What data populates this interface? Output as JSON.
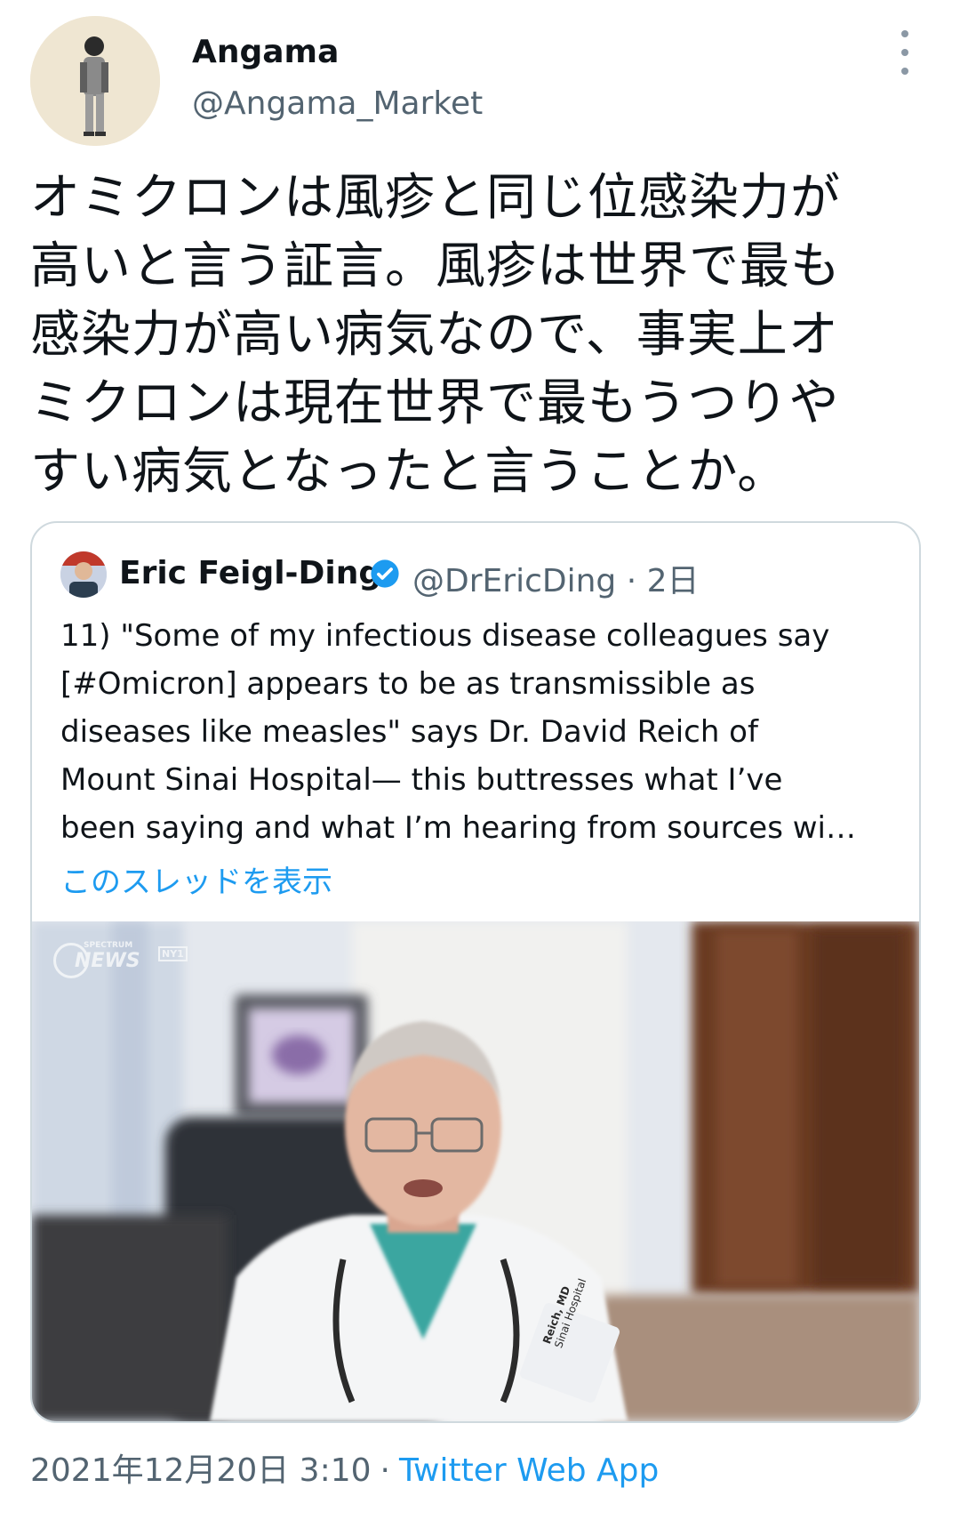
{
  "author": {
    "display_name": "Angama",
    "handle": "@Angama_Market"
  },
  "tweet": {
    "lines": [
      "オミクロンは風疹と同じ位感染力が",
      "高いと言う証言。風疹は世界で最も",
      "感染力が高い病気なので、事実上オ",
      "ミクロンは現在世界で最もうつりや",
      "すい病気となったと言うことか。"
    ]
  },
  "quote": {
    "display_name": "Eric Feigl-Ding",
    "handle_and_time": "@DrEricDing · 2日",
    "lines": [
      "11) \"Some of my infectious disease colleagues say",
      "[#Omicron] appears to be as transmissible as",
      "diseases like measles\" says Dr. David Reich of",
      "Mount Sinai Hospital— this buttresses what I’ve",
      "been saying and what I’m hearing from sources wi…"
    ],
    "show_thread": "このスレッドを表示",
    "video": {
      "watermark_top": "SPECTRUM",
      "watermark": "NEWS",
      "watermark_channel": "NY1",
      "badge_name": "Reich, MD",
      "badge_org": "Sinai Hospital"
    }
  },
  "meta": {
    "timestamp": "2021年12月20日 3:10",
    "separator": "·",
    "source": "Twitter Web App"
  },
  "colors": {
    "accent": "#1d9bf0",
    "secondary_text": "#536471",
    "border": "#cfd9de"
  }
}
